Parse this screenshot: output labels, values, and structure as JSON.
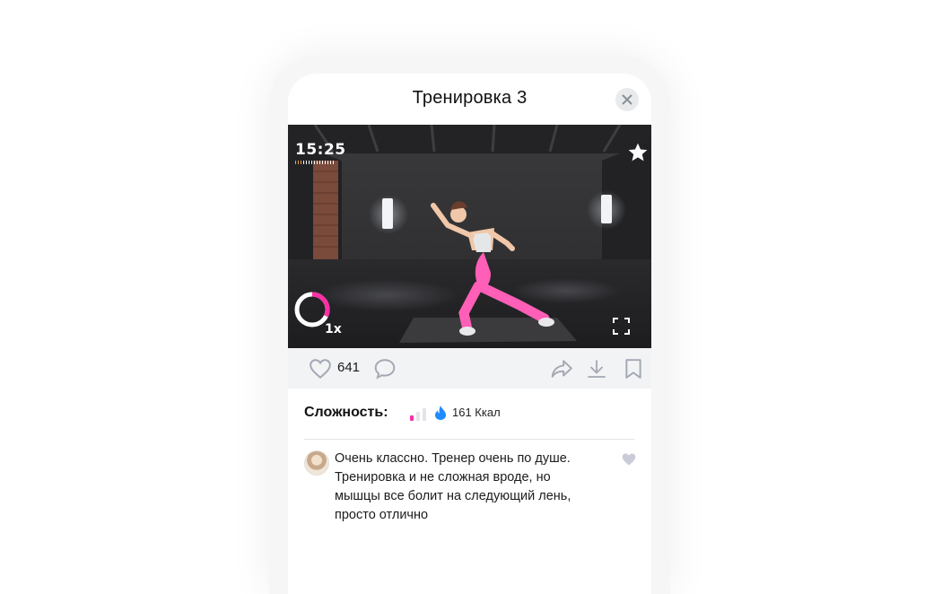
{
  "header": {
    "title": "Тренировка 3"
  },
  "video": {
    "timer": "15:25",
    "speed": "1x",
    "progress_ring_fraction": 0.32
  },
  "actions": {
    "like_count": "641"
  },
  "info": {
    "difficulty_label": "Сложность:",
    "difficulty_level": 1,
    "difficulty_max": 3,
    "calories": "161 Ккал"
  },
  "comment": {
    "text": "Очень классно. Тренер очень по душе. Тренировка и не сложная вроде, но мышцы все болит на следующий лень, просто отлично"
  },
  "colors": {
    "accent": "#ff2ea5",
    "flame": "#1e8cff",
    "icon_gray": "#a3a8b4"
  },
  "icons": [
    "close-icon",
    "star-icon",
    "fullscreen-icon",
    "heart-icon",
    "comment-icon",
    "share-icon",
    "download-icon",
    "bookmark-icon",
    "flame-icon"
  ]
}
